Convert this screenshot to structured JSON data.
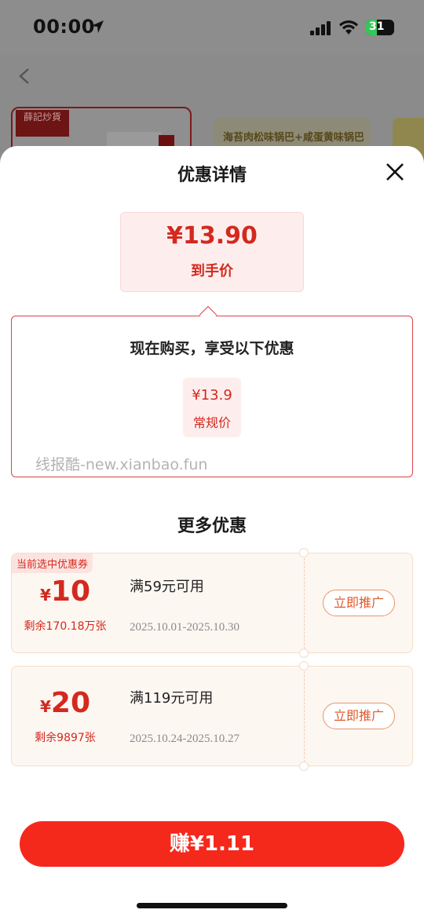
{
  "status_bar": {
    "time": "00:00",
    "battery": "31"
  },
  "background": {
    "brand_text": "薛記炒貨",
    "product_text": "海苔肉松味锅巴+咸蛋黄味锅巴"
  },
  "sheet": {
    "title": "优惠详情",
    "final_price": "¥13.90",
    "final_price_label": "到手价",
    "promo_title": "现在购买，享受以下优惠",
    "regular_price": "¥13.9",
    "regular_price_label": "常规价",
    "watermark": "线报酷-new.xianbao.fun",
    "more_title": "更多优惠",
    "coupons": [
      {
        "tag": "当前选中优惠券",
        "currency": "¥",
        "amount": "10",
        "remaining": "剩余170.18万张",
        "condition": "满59元可用",
        "date_range": "2025.10.01-2025.10.30",
        "button": "立即推广"
      },
      {
        "currency": "¥",
        "amount": "20",
        "remaining": "剩余9897张",
        "condition": "满119元可用",
        "date_range": "2025.10.24-2025.10.27",
        "button": "立即推广"
      }
    ],
    "earn_button": "赚¥1.11"
  },
  "colors": {
    "accent": "#f5281c",
    "price_red": "#d3291e",
    "coupon_bg": "#fdf7f2"
  }
}
